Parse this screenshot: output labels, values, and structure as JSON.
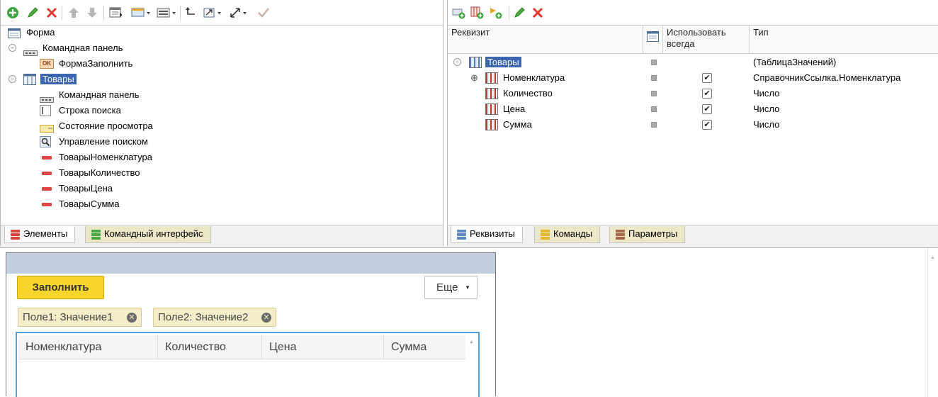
{
  "left_panel": {
    "tree": [
      {
        "label": "Форма",
        "icon": "form-icon"
      },
      {
        "label": "Командная панель",
        "icon": "command-panel-icon"
      },
      {
        "label": "ФормаЗаполнить",
        "icon": "ok-button-icon",
        "badge": "OK"
      },
      {
        "label": "Товары",
        "icon": "table-icon",
        "selected": true
      },
      {
        "label": "Командная панель",
        "icon": "command-panel-icon"
      },
      {
        "label": "Строка поиска",
        "icon": "search-string-icon"
      },
      {
        "label": "Состояние просмотра",
        "icon": "view-status-icon"
      },
      {
        "label": "Управление поиском",
        "icon": "magnifier-icon"
      },
      {
        "label": "ТоварыНоменклатура",
        "icon": "field-icon"
      },
      {
        "label": "ТоварыКоличество",
        "icon": "field-icon"
      },
      {
        "label": "ТоварыЦена",
        "icon": "field-icon"
      },
      {
        "label": "ТоварыСумма",
        "icon": "field-icon"
      }
    ],
    "tabs": [
      "Элементы",
      "Командный интерфейс"
    ]
  },
  "right_panel": {
    "columns": {
      "requisite": "Реквизит",
      "use_always": "Использовать всегда",
      "type": "Тип"
    },
    "rows": [
      {
        "name": "Товары",
        "type": "(ТаблицаЗначений)",
        "checked": false,
        "selected": true
      },
      {
        "name": "Номенклатура",
        "type": "СправочникСсылка.Номенклатура",
        "checked": true
      },
      {
        "name": "Количество",
        "type": "Число",
        "checked": true
      },
      {
        "name": "Цена",
        "type": "Число",
        "checked": true
      },
      {
        "name": "Сумма",
        "type": "Число",
        "checked": true
      }
    ],
    "check_mark": "✔",
    "tabs": [
      "Реквизиты",
      "Команды",
      "Параметры"
    ]
  },
  "preview": {
    "fill_button": "Заполнить",
    "more_button": "Еще",
    "filters": [
      "Поле1: Значение1",
      "Поле2: Значение2"
    ],
    "table_columns": [
      "Номенклатура",
      "Количество",
      "Цена",
      "Сумма"
    ]
  },
  "colors": {
    "selection": "#3c66b0",
    "fill_button": "#f7d52a",
    "tab_inactive": "#ece7c6",
    "preview_header": "#c1cfdf"
  }
}
